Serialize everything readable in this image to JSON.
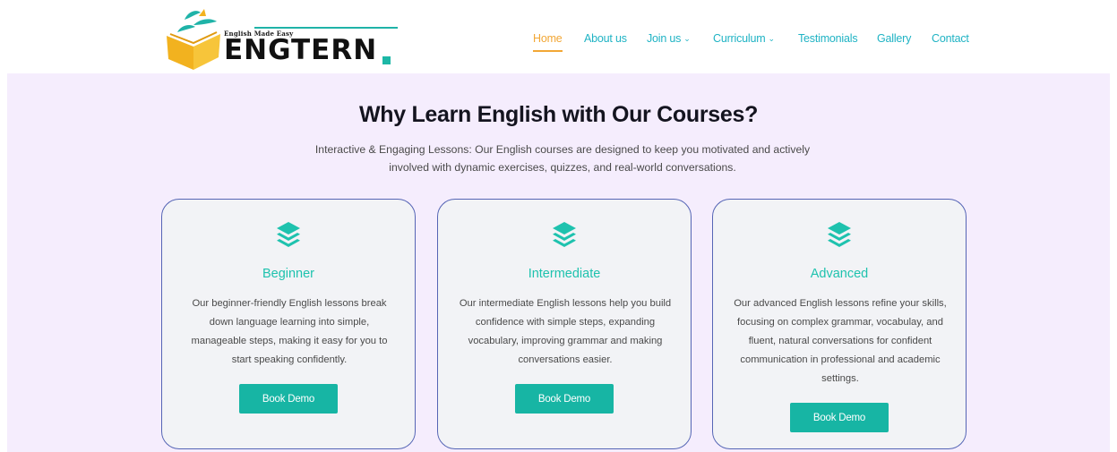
{
  "brand": {
    "tagline": "English Made Easy",
    "name": "ENGTERN"
  },
  "nav": [
    {
      "label": "Home",
      "active": true,
      "dropdown": false
    },
    {
      "label": "About us",
      "active": false,
      "dropdown": false
    },
    {
      "label": "Join us",
      "active": false,
      "dropdown": true
    },
    {
      "label": "Curriculum",
      "active": false,
      "dropdown": true
    },
    {
      "label": "Testimonials",
      "active": false,
      "dropdown": false
    },
    {
      "label": "Gallery",
      "active": false,
      "dropdown": false
    },
    {
      "label": "Contact",
      "active": false,
      "dropdown": false
    }
  ],
  "section": {
    "title": "Why Learn English with Our Courses?",
    "subtitle": "Interactive & Engaging Lessons: Our English courses are designed to keep you motivated and actively involved with dynamic exercises, quizzes, and real-world conversations."
  },
  "cards": [
    {
      "title": "Beginner",
      "description": "Our beginner-friendly English lessons break down language learning into simple, manageable steps, making it easy for you to start speaking confidently.",
      "button": "Book Demo"
    },
    {
      "title": "Intermediate",
      "description": "Our intermediate English lessons help you build confidence with simple steps, expanding vocabulary, improving grammar and making conversations easier.",
      "button": "Book Demo"
    },
    {
      "title": "Advanced",
      "description": "Our advanced English lessons refine your skills, focusing on complex grammar, vocabulay, and fluent, natural conversations for confident communication in professional and academic settings.",
      "button": "Book Demo"
    }
  ],
  "colors": {
    "accent": "#17b5a4",
    "nav_link": "#1fb3c4",
    "nav_active": "#f2a735",
    "section_bg": "#f5edfd",
    "card_border": "#5565b5"
  },
  "icons": {
    "brand": "open-book-logo-icon",
    "card": "layers-icon",
    "dropdown": "chevron-down-icon"
  }
}
